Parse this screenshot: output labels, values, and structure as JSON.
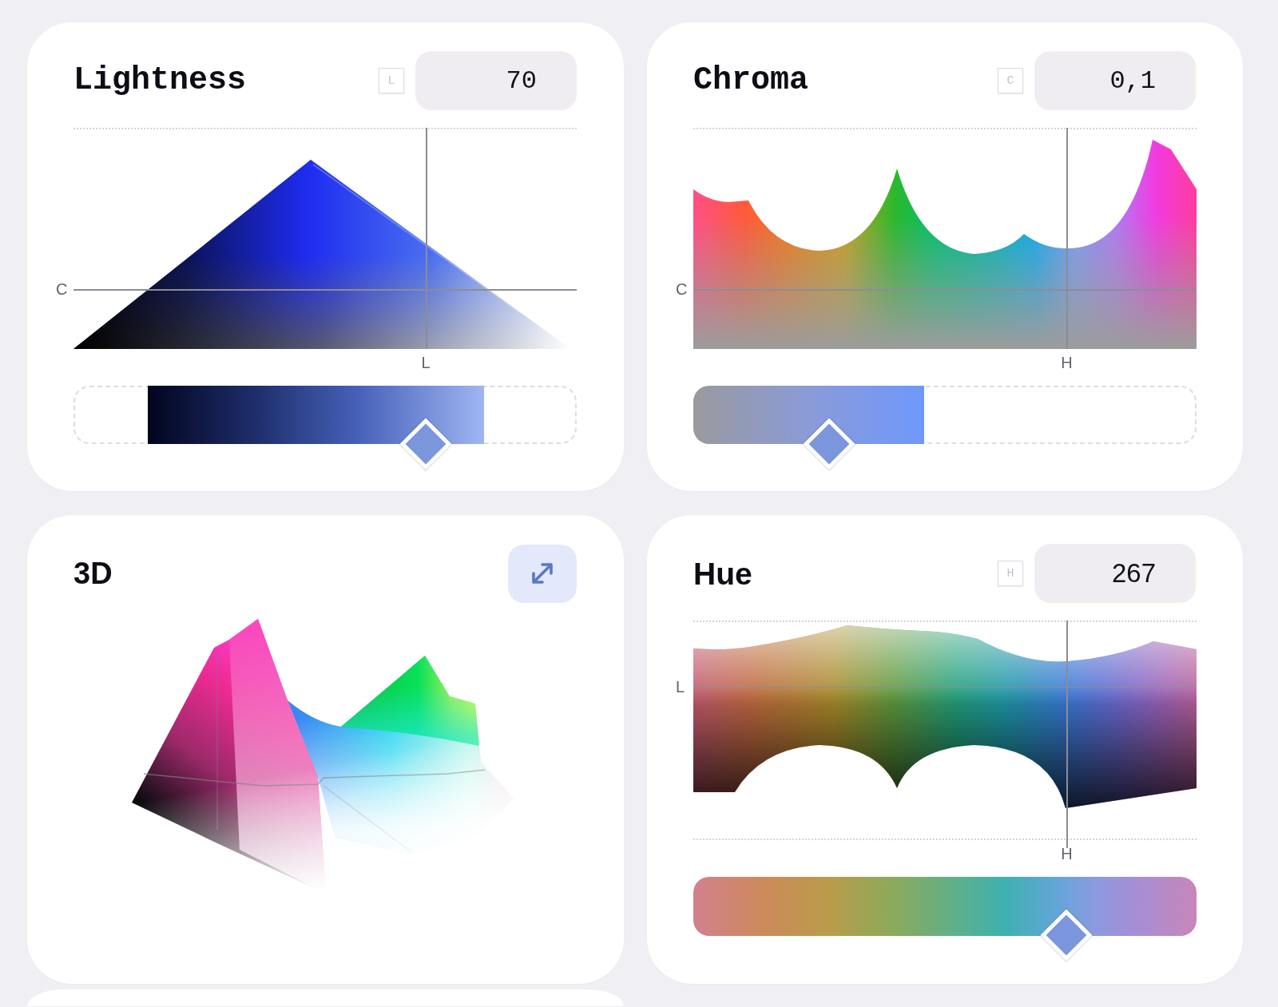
{
  "panels": [
    {
      "kind": "lightness",
      "title": "Lightness",
      "shortcut": "L",
      "value": "70",
      "axis_labels": {
        "horizontal_line": "C",
        "vertical_line": "L"
      },
      "slider": {
        "level": 0.7
      }
    },
    {
      "kind": "chroma",
      "title": "Chroma",
      "shortcut": "C",
      "value": "0,1",
      "axis_labels": {
        "horizontal_line": "C",
        "vertical_line": "H"
      },
      "slider": {
        "level": 0.27
      }
    },
    {
      "kind": "solid",
      "title": "3D"
    },
    {
      "kind": "hue",
      "title": "Hue",
      "shortcut": "H",
      "value": "267",
      "axis_labels": {
        "horizontal_line": "L",
        "vertical_line": "H"
      },
      "slider": {
        "level": 0.742
      }
    }
  ]
}
